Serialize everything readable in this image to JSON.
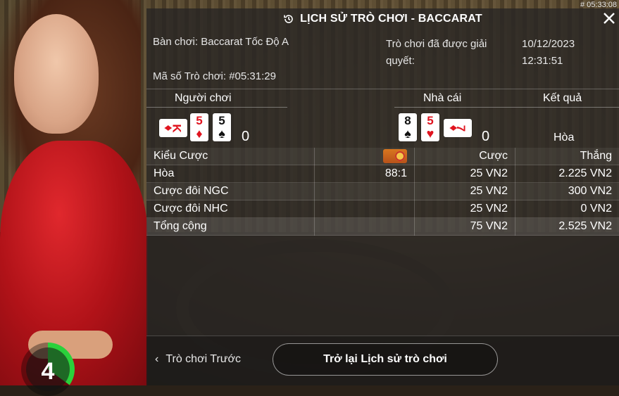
{
  "round_id": "# 05:33:08",
  "timer": {
    "value": "4",
    "progress_percent": 35
  },
  "panel": {
    "title": "LỊCH SỬ TRÒ CHƠI - BACCARAT",
    "info": {
      "table": "Bàn chơi: Baccarat Tốc Độ A",
      "game_id": "Mã số Trò chơi: #05:31:29",
      "settled_label": "Trò chơi đã được giải quyết:",
      "date": "10/12/2023",
      "time": "12:31:51"
    },
    "result": {
      "player_header": "Người chơi",
      "banker_header": "Nhà cái",
      "result_header": "Kết quả",
      "player_cards": [
        {
          "rank": "K",
          "suit": "♦",
          "color": "red",
          "side": true
        },
        {
          "rank": "5",
          "suit": "♦",
          "color": "red",
          "side": false
        },
        {
          "rank": "5",
          "suit": "♠",
          "color": "black",
          "side": false
        }
      ],
      "player_score": "0",
      "banker_cards": [
        {
          "rank": "8",
          "suit": "♠",
          "color": "black",
          "side": false
        },
        {
          "rank": "5",
          "suit": "♥",
          "color": "red",
          "side": false
        },
        {
          "rank": "7",
          "suit": "♦",
          "color": "red",
          "side": true
        }
      ],
      "banker_score": "0",
      "outcome": "Hòa"
    },
    "bets": {
      "headers": {
        "type": "Kiểu Cược",
        "bet": "Cược",
        "win": "Thắng"
      },
      "rows": [
        {
          "type": "Hòa",
          "odds": "88:1",
          "bet": "25 VN2",
          "win": "2.225 VN2"
        },
        {
          "type": "Cược đôi NGC",
          "odds": "",
          "bet": "25 VN2",
          "win": "300 VN2"
        },
        {
          "type": "Cược đôi NHC",
          "odds": "",
          "bet": "25 VN2",
          "win": "0 VN2"
        }
      ],
      "total": {
        "type": "Tổng cộng",
        "bet": "75 VN2",
        "win": "2.525 VN2"
      }
    },
    "footer": {
      "prev_label": "Trò chơi Trước",
      "back_label": "Trở lại Lịch sử trò chơi"
    }
  },
  "colors": {
    "card_red": "#e0141f",
    "timer_green": "#2ad13b"
  }
}
